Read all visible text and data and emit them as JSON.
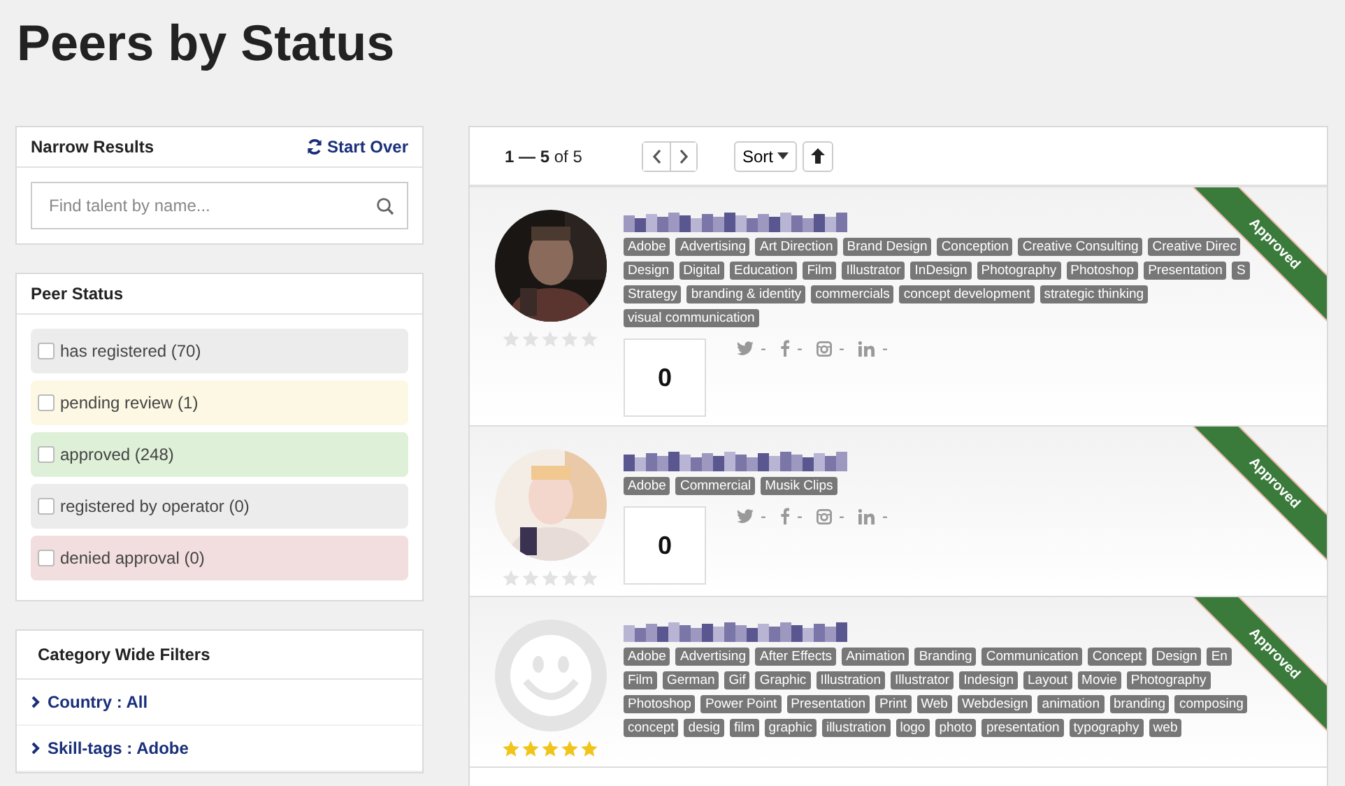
{
  "page_title": "Peers by Status",
  "narrow": {
    "title": "Narrow Results",
    "start_over": "Start Over",
    "search": {
      "placeholder": "Find talent by name..."
    }
  },
  "peer_status": {
    "title": "Peer Status",
    "options": [
      {
        "label": "has registered (70)",
        "checked": false,
        "color": "#ececec"
      },
      {
        "label": "pending review (1)",
        "checked": false,
        "color": "#fcf8e3"
      },
      {
        "label": "approved (248)",
        "checked": false,
        "color": "#dff0d8"
      },
      {
        "label": "registered by operator (0)",
        "checked": false,
        "color": "#ececec"
      },
      {
        "label": "denied approval (0)",
        "checked": false,
        "color": "#f2dede"
      }
    ]
  },
  "category_filters": {
    "title": "Category Wide Filters",
    "items": [
      "Country : All",
      "Skill-tags : Adobe"
    ]
  },
  "toolbar": {
    "range": "**1 — 5** of 5",
    "sort": "Sort"
  },
  "cards": [
    {
      "stars": 0,
      "badge": "Approved",
      "score": "0",
      "socials": [
        "-",
        "-",
        "-",
        "-"
      ],
      "tags": [
        "Adobe",
        "Advertising",
        "Art Direction",
        "Brand Design",
        "Conception",
        "Creative Consulting",
        "Creative Direc",
        "Design",
        "Digital",
        "Education",
        "Film",
        "Illustrator",
        "InDesign",
        "Photography",
        "Photoshop",
        "Presentation",
        "S",
        "Strategy",
        "branding & identity",
        "commercials",
        "concept development",
        "strategic thinking",
        "visual communication"
      ]
    },
    {
      "stars": 0,
      "badge": "Approved",
      "score": "0",
      "socials": [
        "-",
        "-",
        "-",
        "-"
      ],
      "tags": [
        "Adobe",
        "Commercial",
        "Musik Clips"
      ]
    },
    {
      "kind": "placeholder",
      "stars": 5,
      "badge": "Approved",
      "tags": [
        "Adobe",
        "Advertising",
        "After Effects",
        "Animation",
        "Branding",
        "Communication",
        "Concept",
        "Design",
        "En",
        "Film",
        "German",
        "Gif",
        "Graphic",
        "Illustration",
        "Illustrator",
        "Indesign",
        "Layout",
        "Movie",
        "Photography",
        "Photoshop",
        "Power Point",
        "Presentation",
        "Print",
        "Web",
        "Webdesign",
        "animation",
        "branding",
        "composing",
        "concept",
        "desig",
        "film",
        "graphic",
        "illustration",
        "logo",
        "photo",
        "presentation",
        "typography",
        "web"
      ]
    }
  ]
}
